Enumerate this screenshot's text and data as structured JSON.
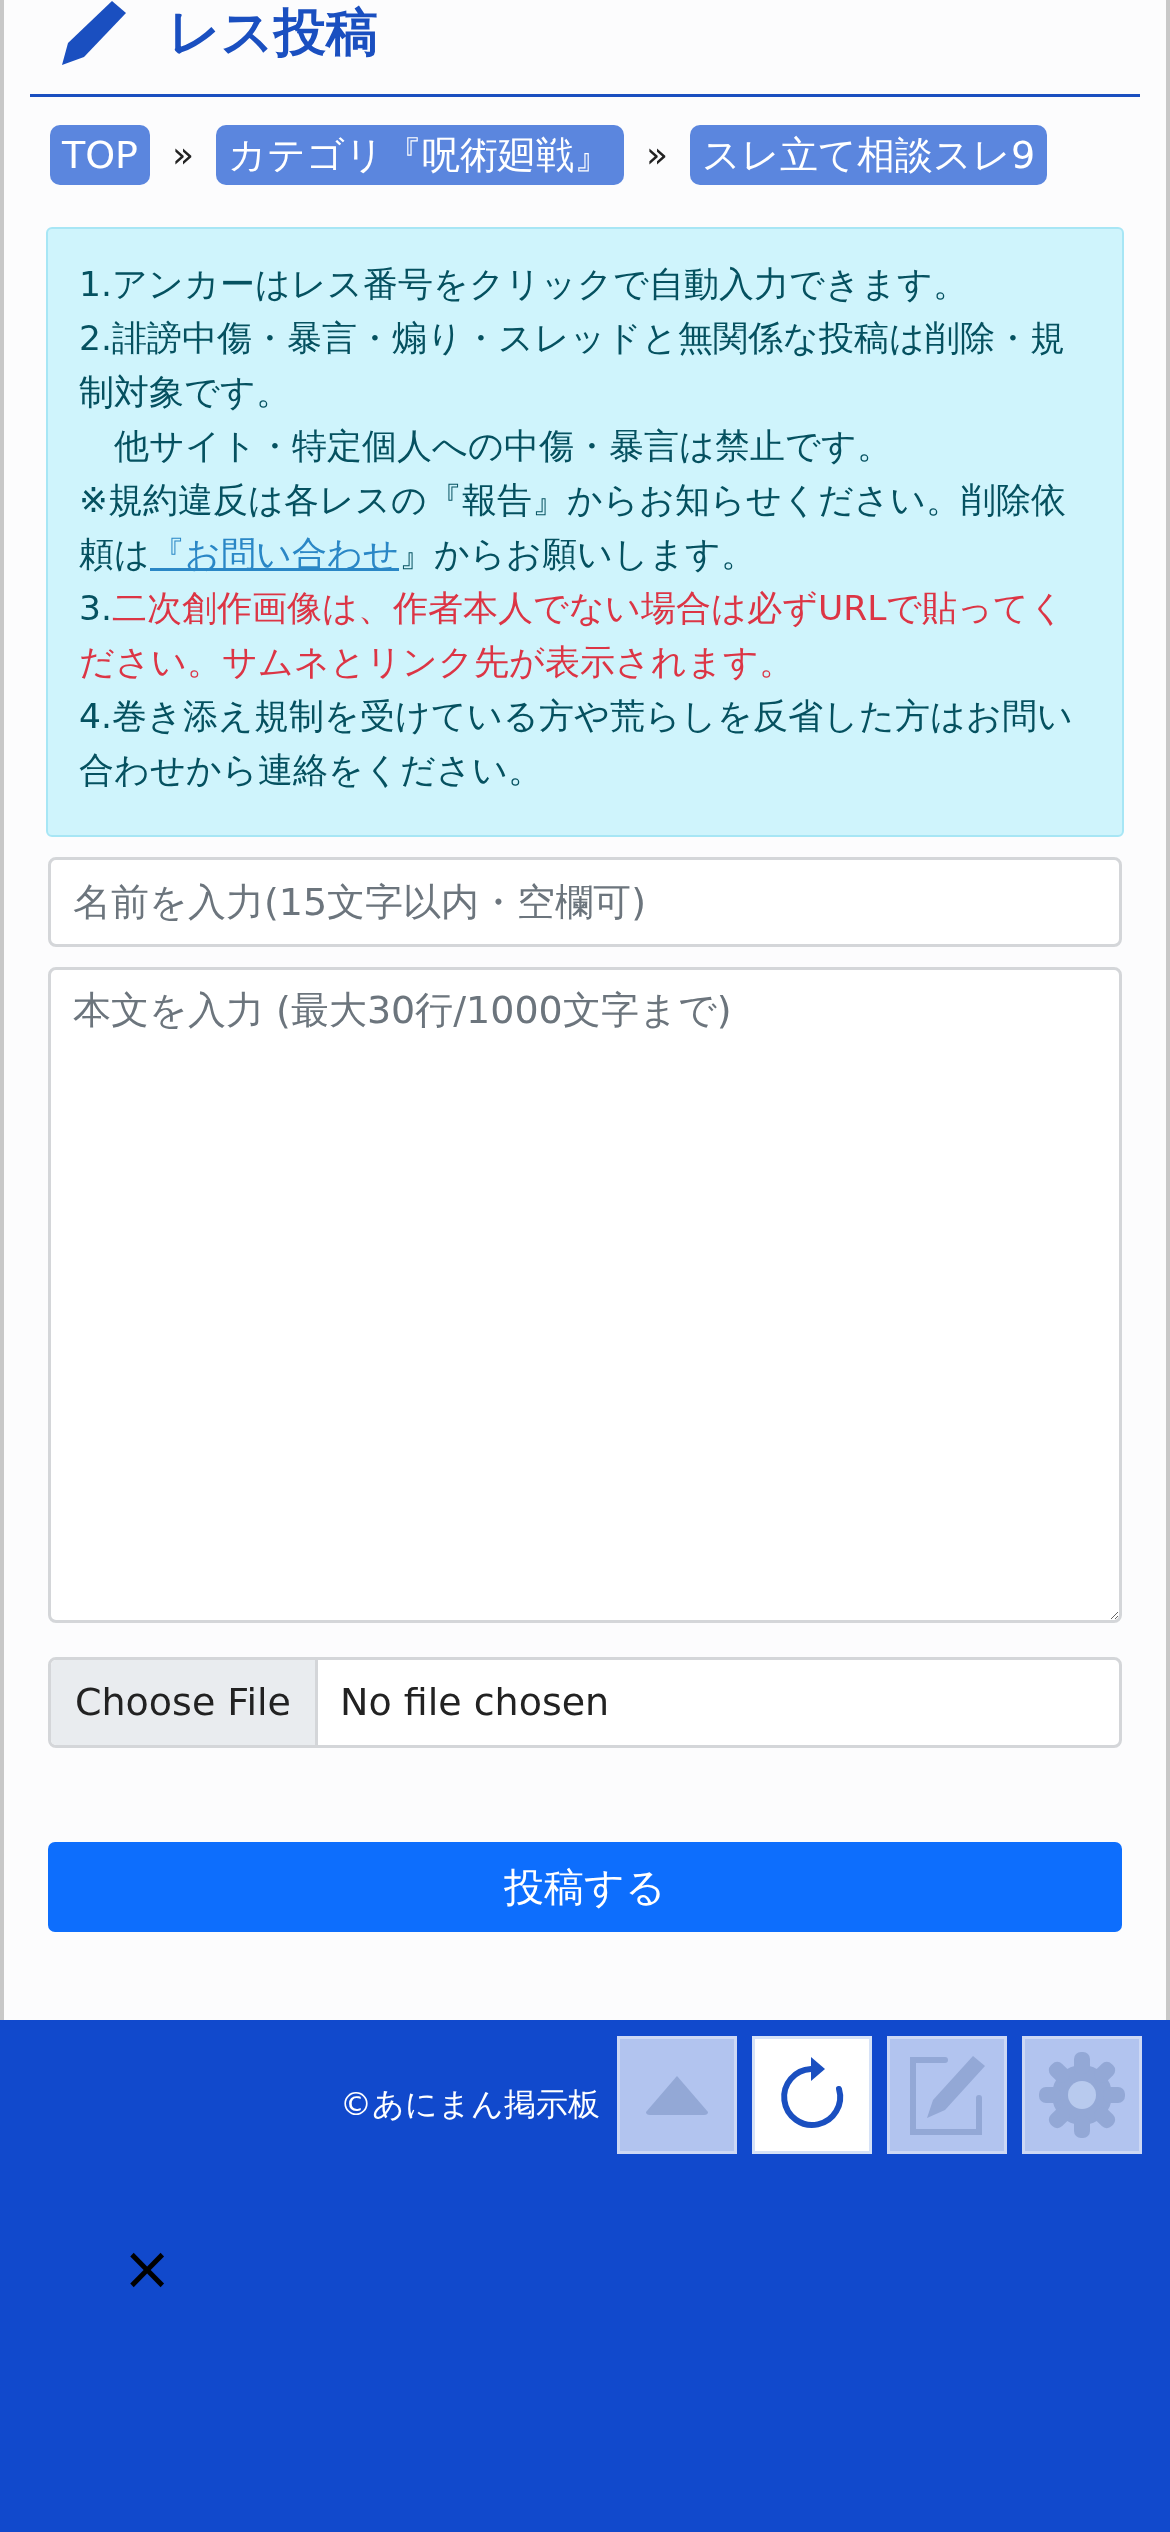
{
  "header": {
    "title": "レス投稿"
  },
  "breadcrumbs": [
    {
      "label": "TOP"
    },
    {
      "label": "カテゴリ『呪術廻戦』"
    },
    {
      "label": "スレ立て相談スレ9"
    }
  ],
  "breadcrumb_separator": "»",
  "notices": [
    {
      "segments": [
        {
          "kind": "plain",
          "text": "1.アンカーはレス番号をクリックで自動入力できます。"
        }
      ]
    },
    {
      "segments": [
        {
          "kind": "plain",
          "text": "2.誹謗中傷・暴言・煽り・スレッドと無関係な投稿は削除・規制対象です。"
        }
      ]
    },
    {
      "segments": [
        {
          "kind": "plain",
          "text": "　他サイト・特定個人への中傷・暴言は禁止です。"
        }
      ]
    },
    {
      "segments": [
        {
          "kind": "plain",
          "text": "※規約違反は各レスの『報告』からお知らせください。削除依頼は"
        },
        {
          "kind": "link",
          "text": "『お問い合わせ"
        },
        {
          "kind": "plain",
          "text": "』からお願いします。"
        }
      ]
    },
    {
      "segments": [
        {
          "kind": "plain",
          "text": "3."
        },
        {
          "kind": "warning",
          "text": "二次創作画像は、作者本人でない場合は必ずURLで貼ってください。サムネとリンク先が表示されます。"
        }
      ]
    },
    {
      "segments": [
        {
          "kind": "plain",
          "text": "4.巻き添え規制を受けている方や荒らしを反省した方はお問い合わせから連絡をください。"
        }
      ]
    }
  ],
  "name_field": {
    "placeholder": "名前を入力(15文字以内・空欄可)"
  },
  "body_field": {
    "placeholder": "本文を入力 (最大30行/1000文字まで)"
  },
  "file_field": {
    "button": "Choose File",
    "status": "No file chosen"
  },
  "submit_button": "投稿する",
  "footer": {
    "copyright": "©あにまん掲示板"
  },
  "toolbar": [
    {
      "kind": "up",
      "active": false
    },
    {
      "kind": "reload",
      "active": true
    },
    {
      "kind": "edit",
      "active": false
    },
    {
      "kind": "settings",
      "active": false
    }
  ],
  "close_button": "×"
}
